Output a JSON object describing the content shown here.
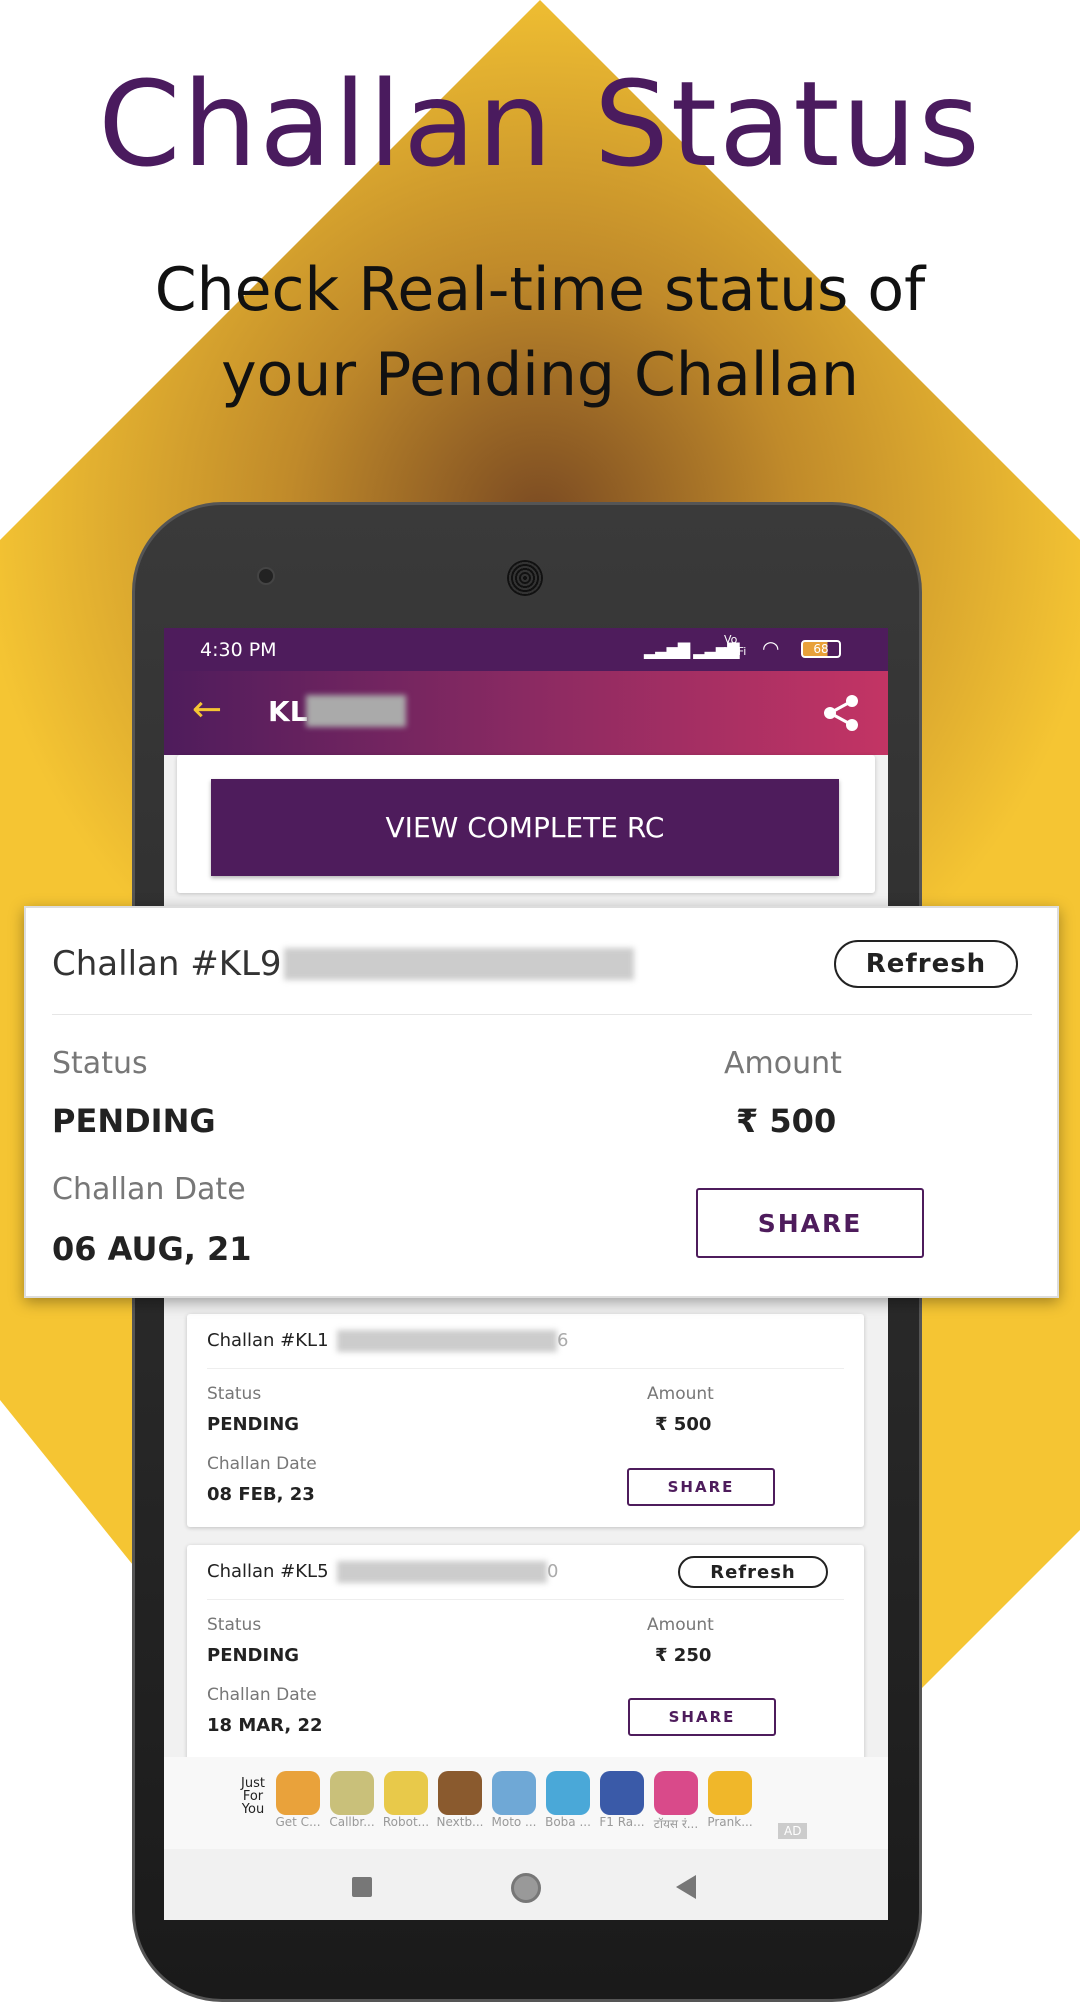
{
  "promo": {
    "title": "Challan Status",
    "subtitle_line1": "Check Real-time status of",
    "subtitle_line2": "your Pending Challan"
  },
  "colors": {
    "accent": "#4e1c5c",
    "highlight": "#f5c533",
    "appbar_end": "#c33464"
  },
  "status_bar": {
    "time": "4:30 PM",
    "vowifi": "Vo WiFi",
    "battery": "68"
  },
  "app_bar": {
    "title": "KL",
    "back_icon": "arrow-left-icon",
    "share_icon": "share-icon"
  },
  "view_rc_button": "VIEW COMPLETE RC",
  "featured_challan": {
    "title": "Challan #KL9",
    "refresh": "Refresh",
    "status_label": "Status",
    "status": "PENDING",
    "amount_label": "Amount",
    "amount": "₹ 500",
    "date_label": "Challan Date",
    "date": "06 AUG, 21",
    "share": "SHARE"
  },
  "challans": [
    {
      "title": "Challan #KL1",
      "suffix": "6",
      "status_label": "Status",
      "status": "PENDING",
      "amount_label": "Amount",
      "amount": "₹ 500",
      "date_label": "Challan Date",
      "date": "08 FEB, 23",
      "share": "SHARE"
    },
    {
      "title": "Challan #KL5",
      "suffix": "0",
      "refresh": "Refresh",
      "status_label": "Status",
      "status": "PENDING",
      "amount_label": "Amount",
      "amount": "₹ 250",
      "date_label": "Challan Date",
      "date": "18 MAR, 22",
      "share": "SHARE"
    }
  ],
  "ad_bar": {
    "heading": "Just For You",
    "ad_badge": "AD",
    "apps": [
      {
        "label": "Get C...",
        "color": "#e9a23b"
      },
      {
        "label": "Callbr...",
        "color": "#c9c07a"
      },
      {
        "label": "Robot...",
        "color": "#e8c94a"
      },
      {
        "label": "Nextb...",
        "color": "#8a5a2e"
      },
      {
        "label": "Moto ...",
        "color": "#6fa8d6"
      },
      {
        "label": "Boba ...",
        "color": "#4aa8d8"
      },
      {
        "label": "F1 Ra...",
        "color": "#3a5aa8"
      },
      {
        "label": "टॉयस रं...",
        "color": "#d94a8a"
      },
      {
        "label": "Prank...",
        "color": "#f0b72a"
      }
    ]
  }
}
